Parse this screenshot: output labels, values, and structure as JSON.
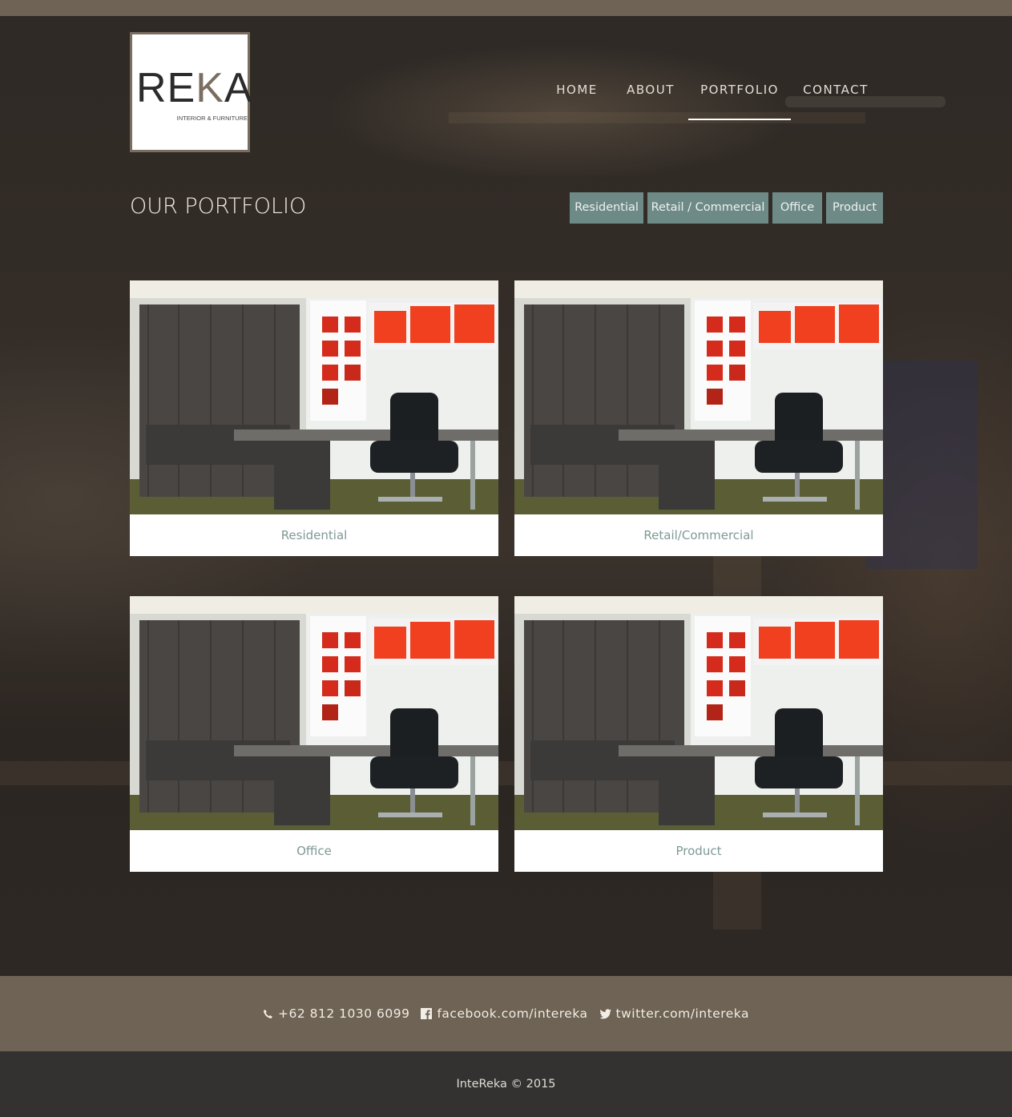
{
  "brand": {
    "logo_main_a": "RE",
    "logo_main_k": "K",
    "logo_main_b": "A",
    "logo_tagline": "INTERIOR & FURNITURE"
  },
  "nav": {
    "items": [
      {
        "label": "HOME",
        "active": false
      },
      {
        "label": "ABOUT",
        "active": false
      },
      {
        "label": "PORTFOLIO",
        "active": true
      },
      {
        "label": "CONTACT",
        "active": false
      }
    ]
  },
  "portfolio": {
    "title": "OUR PORTFOLIO",
    "filters": [
      "Residential",
      "Retail / Commercial",
      "Office",
      "Product"
    ],
    "cards": [
      {
        "caption": "Residential",
        "image": "office-interior-photo"
      },
      {
        "caption": "Retail/Commercial",
        "image": "office-interior-photo"
      },
      {
        "caption": "Office",
        "image": "office-interior-photo"
      },
      {
        "caption": "Product",
        "image": "office-interior-photo"
      }
    ]
  },
  "contact": {
    "phone": "+62 812 1030 6099",
    "facebook": "facebook.com/intereka",
    "twitter": "twitter.com/intereka",
    "phone_icon": "phone-icon",
    "facebook_icon": "facebook-icon",
    "twitter_icon": "twitter-icon"
  },
  "footer": {
    "copyright": "InteReka © 2015"
  },
  "colors": {
    "accent_bar": "#6e6354",
    "filter_button": "#6e8a87",
    "caption_text": "#7d9a95",
    "footer_bg": "#333231"
  }
}
